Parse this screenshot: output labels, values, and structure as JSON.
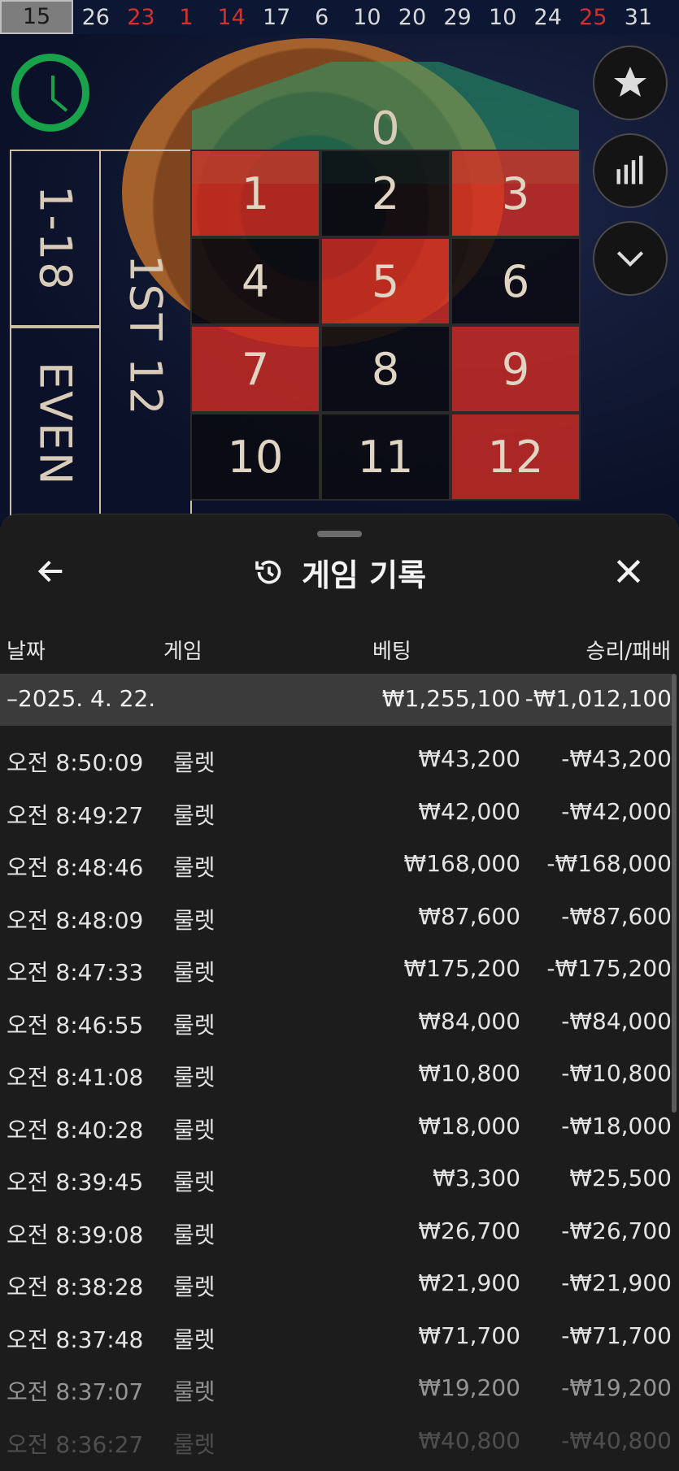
{
  "results_strip": {
    "numbers": [
      {
        "value": "15",
        "color": "first"
      },
      {
        "value": "26",
        "color": "black"
      },
      {
        "value": "23",
        "color": "red"
      },
      {
        "value": "1",
        "color": "red"
      },
      {
        "value": "14",
        "color": "red"
      },
      {
        "value": "17",
        "color": "black"
      },
      {
        "value": "6",
        "color": "black"
      },
      {
        "value": "10",
        "color": "black"
      },
      {
        "value": "20",
        "color": "black"
      },
      {
        "value": "29",
        "color": "black"
      },
      {
        "value": "10",
        "color": "black"
      },
      {
        "value": "24",
        "color": "black"
      },
      {
        "value": "25",
        "color": "red"
      },
      {
        "value": "31",
        "color": "black"
      }
    ]
  },
  "table": {
    "zero": "0",
    "outside": {
      "low": "1-18",
      "even": "EVEN",
      "dozen": "1ST 12"
    },
    "numbers": [
      {
        "n": "1",
        "c": "r"
      },
      {
        "n": "2",
        "c": "b"
      },
      {
        "n": "3",
        "c": "r"
      },
      {
        "n": "4",
        "c": "b"
      },
      {
        "n": "5",
        "c": "r"
      },
      {
        "n": "6",
        "c": "b"
      },
      {
        "n": "7",
        "c": "r"
      },
      {
        "n": "8",
        "c": "b"
      },
      {
        "n": "9",
        "c": "r"
      },
      {
        "n": "10",
        "c": "b"
      },
      {
        "n": "11",
        "c": "b"
      },
      {
        "n": "12",
        "c": "r"
      }
    ]
  },
  "sheet": {
    "title": "게임 기록",
    "columns": {
      "date": "날짜",
      "game": "게임",
      "bet": "베팅",
      "result": "승리/패배"
    },
    "summary": {
      "date": "–2025. 4. 22.",
      "bet": "₩1,255,100",
      "result": "-₩1,012,100"
    },
    "rows": [
      {
        "time": "오전 8:50:09",
        "game": "룰렛",
        "bet": "₩43,200",
        "result": "-₩43,200"
      },
      {
        "time": "오전 8:49:27",
        "game": "룰렛",
        "bet": "₩42,000",
        "result": "-₩42,000"
      },
      {
        "time": "오전 8:48:46",
        "game": "룰렛",
        "bet": "₩168,000",
        "result": "-₩168,000"
      },
      {
        "time": "오전 8:48:09",
        "game": "룰렛",
        "bet": "₩87,600",
        "result": "-₩87,600"
      },
      {
        "time": "오전 8:47:33",
        "game": "룰렛",
        "bet": "₩175,200",
        "result": "-₩175,200"
      },
      {
        "time": "오전 8:46:55",
        "game": "룰렛",
        "bet": "₩84,000",
        "result": "-₩84,000"
      },
      {
        "time": "오전 8:41:08",
        "game": "룰렛",
        "bet": "₩10,800",
        "result": "-₩10,800"
      },
      {
        "time": "오전 8:40:28",
        "game": "룰렛",
        "bet": "₩18,000",
        "result": "-₩18,000"
      },
      {
        "time": "오전 8:39:45",
        "game": "룰렛",
        "bet": "₩3,300",
        "result": "₩25,500"
      },
      {
        "time": "오전 8:39:08",
        "game": "룰렛",
        "bet": "₩26,700",
        "result": "-₩26,700"
      },
      {
        "time": "오전 8:38:28",
        "game": "룰렛",
        "bet": "₩21,900",
        "result": "-₩21,900"
      },
      {
        "time": "오전 8:37:48",
        "game": "룰렛",
        "bet": "₩71,700",
        "result": "-₩71,700"
      },
      {
        "time": "오전 8:37:07",
        "game": "룰렛",
        "bet": "₩19,200",
        "result": "-₩19,200"
      },
      {
        "time": "오전 8:36:27",
        "game": "룰렛",
        "bet": "₩40,800",
        "result": "-₩40,800"
      }
    ]
  },
  "icons": {
    "favorites": "star-icon",
    "statistics": "bar-chart-icon",
    "collapse": "chevron-down-icon",
    "timer": "clock-icon",
    "back": "arrow-left-icon",
    "history": "history-icon",
    "close": "close-icon"
  },
  "colors": {
    "red": "#d72d23",
    "green": "#18a34a",
    "sheet_bg": "#1c1c1c",
    "summary_bg": "#3b3b3b"
  }
}
